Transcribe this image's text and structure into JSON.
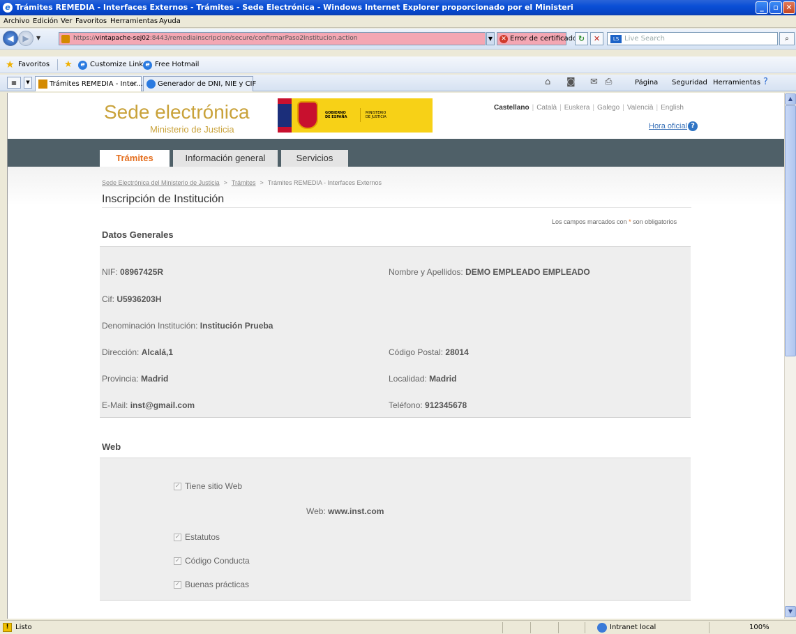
{
  "window": {
    "title": "Trámites REMEDIA - Interfaces Externos - Trámites - Sede Electrónica - Windows Internet Explorer proporcionado por el Ministeri"
  },
  "menu": {
    "items": [
      "Archivo",
      "Edición",
      "Ver",
      "Favoritos",
      "Herramientas",
      "Ayuda"
    ]
  },
  "address": {
    "scheme": "https://",
    "host": "vintapache-sej02",
    "path": ":8443/remediainscripcion/secure/confirmarPaso2Institucion.action",
    "cert_error": "Error de certificado",
    "search_placeholder": "Live Search"
  },
  "favorites": {
    "label": "Favoritos",
    "links": [
      "Customize Links",
      "Free Hotmail"
    ]
  },
  "tabs": {
    "items": [
      "Trámites REMEDIA - Inter...",
      "Generador de DNI, NIE y CIF"
    ],
    "commands": [
      "Página",
      "Seguridad",
      "Herramientas"
    ]
  },
  "site": {
    "title": "Sede electrónica",
    "subtitle": "Ministerio de Justicia",
    "logo_left": [
      "GOBIERNO",
      "DE ESPAÑA"
    ],
    "logo_right": [
      "MINISTERIO",
      "DE JUSTICIA"
    ],
    "languages": [
      "Castellano",
      "Català",
      "Euskera",
      "Galego",
      "Valencià",
      "English"
    ],
    "official_time": "Hora oficial",
    "nav": [
      "Trámites",
      "Información general",
      "Servicios"
    ],
    "breadcrumb": [
      "Sede Electrónica del Ministerio de Justicia",
      "Trámites",
      "Trámites REMEDIA - Interfaces Externos"
    ]
  },
  "page": {
    "title": "Inscripción de Institución",
    "required_note_pre": "Los campos marcados con",
    "required_note_mark": "*",
    "required_note_post": "son obligatorios",
    "general": {
      "title": "Datos Generales",
      "nif_label": "NIF:",
      "nif": "08967425R",
      "name_label": "Nombre y Apellidos:",
      "name": "DEMO EMPLEADO EMPLEADO",
      "cif_label": "Cif:",
      "cif": "U5936203H",
      "den_label": "Denominación Institución:",
      "den": "Institución Prueba",
      "dir_label": "Dirección:",
      "dir": "Alcalá,1",
      "cp_label": "Código Postal:",
      "cp": "28014",
      "prov_label": "Provincia:",
      "prov": "Madrid",
      "loc_label": "Localidad:",
      "loc": "Madrid",
      "email_label": "E-Mail:",
      "email": "inst@gmail.com",
      "tel_label": "Teléfono:",
      "tel": "912345678"
    },
    "web": {
      "title": "Web",
      "has_site": "Tiene sitio Web",
      "web_label": "Web:",
      "web": "www.inst.com",
      "statutes": "Estatutos",
      "code": "Código Conducta",
      "practices": "Buenas prácticas"
    }
  },
  "status": {
    "text": "Listo",
    "zone": "Intranet local",
    "zoom": "100%"
  }
}
